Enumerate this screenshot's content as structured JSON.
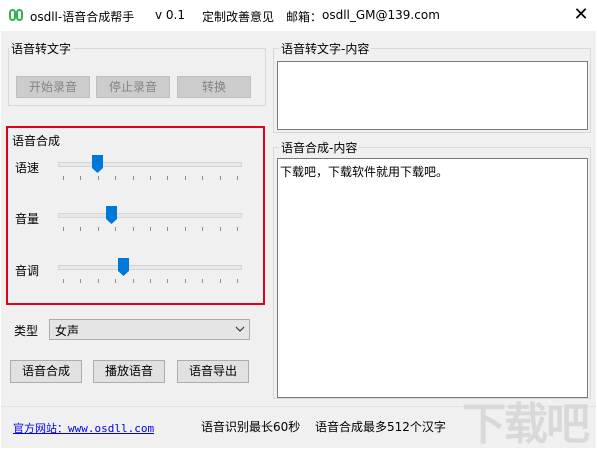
{
  "window": {
    "app_name": "osdll-语音合成帮手",
    "version": "v 0.1",
    "feedback": "定制改善意见",
    "email_prefix": "邮箱：",
    "email": "osdll_GM@139.com",
    "close_glyph": "✕"
  },
  "stt_group": {
    "title": "语音转文字",
    "buttons": {
      "start": "开始录音",
      "stop": "停止录音",
      "convert": "转换"
    }
  },
  "tts_group": {
    "title": "语音合成",
    "sliders": {
      "speed": {
        "label": "语速",
        "value_fraction": 0.2
      },
      "volume": {
        "label": "音量",
        "value_fraction": 0.28
      },
      "pitch": {
        "label": "音调",
        "value_fraction": 0.35
      }
    }
  },
  "type_select": {
    "label": "类型",
    "value": "女声"
  },
  "action_buttons": {
    "synthesize": "语音合成",
    "play": "播放语音",
    "export": "语音导出"
  },
  "stt_content": {
    "title": "语音转文字-内容",
    "text": ""
  },
  "tts_content": {
    "title": "语音合成-内容",
    "text": "下载吧，下载软件就用下载吧。"
  },
  "status": {
    "site_label": "官方网站：www.osdll.com",
    "stt_limit": "语音识别最长60秒",
    "tts_limit": "语音合成最多512个汉字"
  },
  "watermark": {
    "text": "下载吧"
  },
  "colors": {
    "accent": "#0078d7",
    "highlight_border": "#e0001a",
    "link": "#0000ee",
    "app_icon": "#2db34a"
  },
  "icons": {
    "app": "app-logo-icon",
    "close": "close-icon",
    "dropdown": "chevron-down-icon",
    "slider_thumb": "slider-thumb-icon"
  }
}
